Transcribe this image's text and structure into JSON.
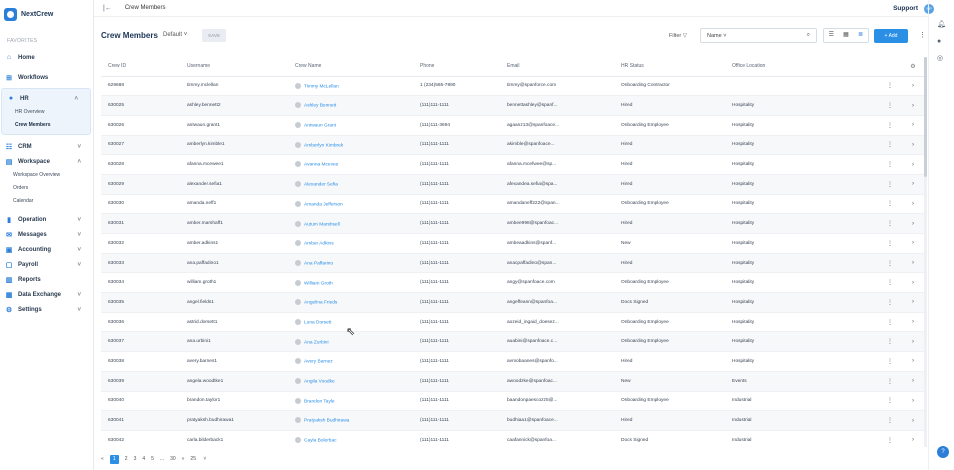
{
  "app": {
    "name": "NextCrew"
  },
  "sidebar": {
    "favorites_label": "FAVORITES",
    "items": [
      {
        "label": "Home",
        "icon": "home-icon"
      },
      {
        "label": "Workflows",
        "icon": "workflows-icon"
      },
      {
        "label": "HR",
        "icon": "user-icon"
      },
      {
        "label": "CRM",
        "icon": "crm-icon"
      },
      {
        "label": "Workspace",
        "icon": "workspace-icon"
      },
      {
        "label": "Operation",
        "icon": "operation-icon"
      },
      {
        "label": "Messages",
        "icon": "messages-icon"
      },
      {
        "label": "Accounting",
        "icon": "accounting-icon"
      },
      {
        "label": "Payroll",
        "icon": "payroll-icon"
      },
      {
        "label": "Reports",
        "icon": "reports-icon"
      },
      {
        "label": "Data Exchange",
        "icon": "data-exchange-icon"
      },
      {
        "label": "Settings",
        "icon": "settings-icon"
      }
    ],
    "hr_sub": [
      "HR Overview",
      "Crew Members"
    ],
    "workspace_sub": [
      "Workspace Overview",
      "Orders",
      "Calendar"
    ]
  },
  "topbar": {
    "breadcrumb": "Crew Members",
    "support": "Support",
    "avatar": "SP"
  },
  "header": {
    "title": "Crew Members",
    "view": "Default",
    "save_label": "SAVE",
    "filter_label": "Filter",
    "search_field": "Name",
    "add_label": "+ Add"
  },
  "table": {
    "columns": [
      "Crew ID",
      "Username",
      "Crew Name",
      "Phone",
      "Email",
      "HR Status",
      "Office Location"
    ],
    "rows": [
      [
        "629688",
        "timmy.mclellan",
        "Timmy McLellan",
        "1 (234)565-7890",
        "timmy@spanforce.com",
        "Onboarding Contractor",
        ""
      ],
      [
        "630025",
        "ashley.bennett2",
        "Ashley Bennett",
        "(111)111-1111",
        "bennettashley@spanf...",
        "Hired",
        "Hospitality"
      ],
      [
        "630026",
        "antwaun.grant1",
        "Antwaun Grant",
        "(111)111-3694",
        "agaanz13@spanfoace...",
        "Onboarding Employee",
        "Hospitality"
      ],
      [
        "630027",
        "amberlyn.kimble1",
        "Amberlyn Kimbrek",
        "(111)111-1111",
        "akimble@spanfoace...",
        "Hired",
        "Hospitality"
      ],
      [
        "630028",
        "afanna.mcewee1",
        "Avanna Mcevee",
        "(111)111-1111",
        "afanna.mcefwee@sp...",
        "Hired",
        "Hospitality"
      ],
      [
        "630029",
        "alexander.sefia1",
        "Alexander Sefia",
        "(111)111-1111",
        "afexandea.sefia@spa...",
        "Hired",
        "Hospitality"
      ],
      [
        "630030",
        "amanda.neff1",
        "Amanda Jefferson",
        "(111)111-1111",
        "amandaneff222@span...",
        "Onboarding Employee",
        "Hospitality"
      ],
      [
        "630031",
        "amber.marshaff1",
        "Autum Marshsell",
        "(111)111-1111",
        "ambee998@spanfoac...",
        "Hired",
        "Hospitality"
      ],
      [
        "630032",
        "amber.adkins1",
        "Amber Adkins",
        "(111)111-1111",
        "ambeaadkins@spanf...",
        "New",
        "Hospitality"
      ],
      [
        "630033",
        "ana.paffadino1",
        "Ana Paffarino",
        "(111)111-1111",
        "anacpaffadino@span...",
        "Hired",
        "Hospitality"
      ],
      [
        "630034",
        "william.groth1",
        "William Groth",
        "(111)111-1111",
        "angy@spanfoace.com",
        "Onboarding Employee",
        "Hospitality"
      ],
      [
        "630035",
        "angel.fields1",
        "Angelina Frieds",
        "(111)111-1111",
        "angeffeann@spanfoa...",
        "Docs Signed",
        "Hospitality"
      ],
      [
        "630036",
        "astrid.dorsett1",
        "Luna Dorsett",
        "(111)111-1111",
        "aozeid_ingaid_doesez...",
        "Onboarding Employee",
        "Hospitality"
      ],
      [
        "630037",
        "ana.urbini1",
        "Ana Zurbini",
        "(111)111-1111",
        "auabini@spanfoace.c...",
        "Onboarding Employee",
        "Hospitality"
      ],
      [
        "630038",
        "avery.barnes1",
        "Avery Barnez",
        "(111)111-1111",
        "avmobaanes@spanfo...",
        "Hired",
        "Hospitality"
      ],
      [
        "630039",
        "angela.woodtke1",
        "Angila Voodke",
        "(111)111-1111",
        "awoodzke@spanfoac...",
        "New",
        "Events"
      ],
      [
        "630040",
        "brandon.taylor1",
        "Brandon Tayle",
        "(111)111-1111",
        "baandonpaescozz5@...",
        "Onboarding Employee",
        "Industrial"
      ],
      [
        "630041",
        "pratyaksh.budhirawa1",
        "Pratyaksh Budhirawa",
        "(111)111-1111",
        "budhiaa1@spanfoace...",
        "Hired",
        "Industrial"
      ],
      [
        "630042",
        "carla.bilderback1",
        "Cayla Bolerbac",
        "(111)111-1111",
        "caafannick@spanfoa...",
        "Docs Signed",
        "Industrial"
      ]
    ]
  },
  "pager": {
    "prev": "«",
    "pages": [
      "1",
      "2",
      "3",
      "4",
      "5",
      "...",
      "30"
    ],
    "next": "»",
    "page_size": "25"
  }
}
